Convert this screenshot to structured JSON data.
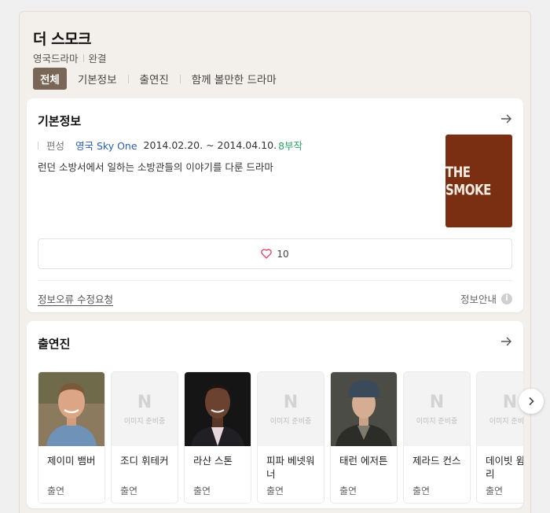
{
  "header": {
    "title": "더 스모크",
    "genre": "영국드라마",
    "status": "완결",
    "tabs": [
      "전체",
      "기본정보",
      "출연진",
      "함께 볼만한 드라마"
    ]
  },
  "basic_info": {
    "section_title": "기본정보",
    "label": "편성",
    "channel": "영국 Sky One",
    "dates": "2014.02.20. ~ 2014.04.10.",
    "episodes": "8부작",
    "description": "런던 소방서에서 일하는 소방관들의 이야기를 다룬 드라마",
    "poster_text": "THE SMOKE",
    "like_count": "10",
    "report_link": "정보오류 수정요청",
    "info_guide": "정보안내"
  },
  "cast": {
    "section_title": "출연진",
    "placeholder_text": "이미지 준비중",
    "members": [
      {
        "name": "제이미 뱀버",
        "role": "출연"
      },
      {
        "name": "조디 휘테커",
        "role": "출연"
      },
      {
        "name": "라샨 스톤",
        "role": "출연"
      },
      {
        "name": "피파 베넷워너",
        "role": "출연"
      },
      {
        "name": "태런 에저튼",
        "role": "출연"
      },
      {
        "name": "제라드 컨스",
        "role": "출연"
      },
      {
        "name": "데이빗 윔슬리",
        "role": "출연"
      }
    ]
  },
  "colors": {
    "tab_active": "#7a6656",
    "channel": "#2a5db0",
    "episodes": "#2aa36b",
    "poster": "#7a2f12"
  }
}
